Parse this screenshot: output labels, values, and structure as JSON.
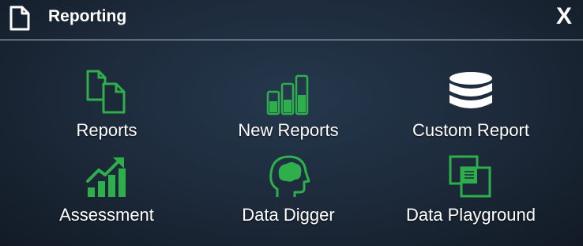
{
  "header": {
    "title": "Reporting",
    "close_label": "X"
  },
  "tiles": [
    {
      "label": "Reports",
      "icon": "documents-icon"
    },
    {
      "label": "New Reports",
      "icon": "bar-chart-icon"
    },
    {
      "label": "Custom Report",
      "icon": "database-icon"
    },
    {
      "label": "Assessment",
      "icon": "trend-chart-icon"
    },
    {
      "label": "Data Digger",
      "icon": "head-brain-icon"
    },
    {
      "label": "Data Playground",
      "icon": "overlapping-squares-icon"
    }
  ],
  "colors": {
    "accent": "#2fae4c",
    "text": "#ffffff",
    "background": "#1c2939"
  }
}
